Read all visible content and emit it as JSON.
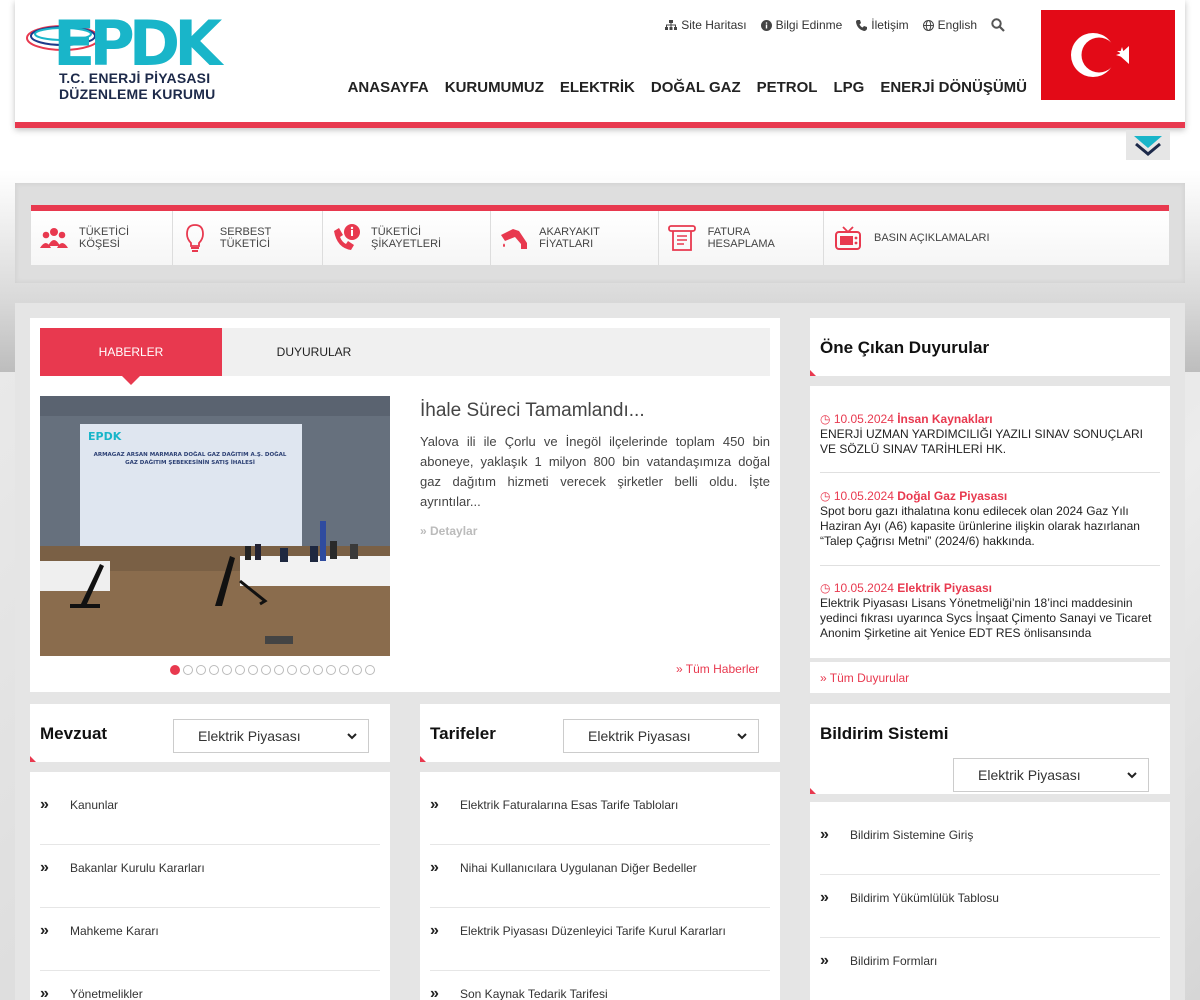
{
  "logo": {
    "text": "EPDK",
    "line1": "T.C. ENERJİ PİYASASI",
    "line2": "DÜZENLEME KURUMU"
  },
  "top_links": [
    {
      "label": "Site Haritası",
      "icon": "sitemap-icon"
    },
    {
      "label": "Bilgi Edinme",
      "icon": "info-icon"
    },
    {
      "label": "İletişim",
      "icon": "phone-icon"
    },
    {
      "label": "English",
      "icon": "globe-icon"
    }
  ],
  "main_nav": [
    "ANASAYFA",
    "KURUMUMUZ",
    "ELEKTRİK",
    "DOĞAL GAZ",
    "PETROL",
    "LPG",
    "ENERJİ DÖNÜŞÜMÜ"
  ],
  "quick_links": [
    {
      "label": "TÜKETİCİ KÖŞESİ",
      "icon": "people-icon"
    },
    {
      "label": "SERBEST TÜKETİCİ",
      "icon": "lightbulb-icon"
    },
    {
      "label": "TÜKETİCİ ŞİKAYETLERİ",
      "icon": "complaint-phone-icon"
    },
    {
      "label": "AKARYAKIT FİYATLARI",
      "icon": "fuel-nozzle-icon"
    },
    {
      "label": "FATURA HESAPLAMA",
      "icon": "invoice-icon"
    },
    {
      "label": "BASIN AÇIKLAMALARI",
      "icon": "tv-icon"
    }
  ],
  "news": {
    "tabs": [
      "HABERLER",
      "DUYURULAR"
    ],
    "title": "İhale Süreci Tamamlandı...",
    "body": "Yalova ili ile Çorlu ve İnegöl ilçelerinde toplam 450 bin aboneye, yaklaşık 1 milyon 800 bin vatandaşımıza doğal gaz dağıtım hizmeti verecek şirketler belli oldu. İşte ayrıntılar...",
    "details": "Detaylar",
    "all_news": "Tüm Haberler",
    "slide_count": 16,
    "active_slide": 1,
    "screen_logo": "EPDK",
    "screen_text": "ARMAGAZ ARSAN MARMARA DOĞAL GAZ DAĞITIM A.Ş. DOĞAL GAZ DAĞITIM ŞEBEKESİNİN SATIŞ İHALESİ"
  },
  "featured": {
    "title": "Öne Çıkan Duyurular",
    "items": [
      {
        "date": "10.05.2024",
        "category": "İnsan Kaynakları",
        "text": "ENERJİ UZMAN YARDIMCILIĞI YAZILI SINAV SONUÇLARI VE SÖZLÜ SINAV TARİHLERİ HK."
      },
      {
        "date": "10.05.2024",
        "category": "Doğal Gaz Piyasası",
        "text": "Spot boru gazı ithalatına konu edilecek olan 2024 Gaz Yılı Haziran Ayı (A6) kapasite ürünlerine ilişkin olarak hazırlanan “Talep Çağrısı Metni” (2024/6) hakkında."
      },
      {
        "date": "10.05.2024",
        "category": "Elektrik Piyasası",
        "text": "Elektrik Piyasası Lisans Yönetmeliği’nin 18’inci maddesinin yedinci fıkrası uyarınca Sycs İnşaat Çimento Sanayi ve Ticaret Anonim Şirketine ait Yenice EDT RES önlisansında"
      }
    ],
    "all": "Tüm Duyurular"
  },
  "mevzuat": {
    "title": "Mevzuat",
    "select": "Elektrik Piyasası",
    "items": [
      "Kanunlar",
      "Bakanlar Kurulu Kararları",
      "Mahkeme Kararı",
      "Yönetmelikler"
    ]
  },
  "tarifeler": {
    "title": "Tarifeler",
    "select": "Elektrik Piyasası",
    "items": [
      "Elektrik Faturalarına Esas Tarife Tabloları",
      "Nihai Kullanıcılara Uygulanan Diğer Bedeller",
      "Elektrik Piyasası Düzenleyici Tarife Kurul Kararları",
      "Son Kaynak Tedarik Tarifesi"
    ]
  },
  "bildirim": {
    "title": "Bildirim Sistemi",
    "select": "Elektrik Piyasası",
    "items": [
      "Bildirim Sistemine Giriş",
      "Bildirim Yükümlülük Tablosu",
      "Bildirim Formları"
    ]
  },
  "colors": {
    "accent": "#e8394f",
    "logo_teal": "#19b5c9",
    "flag_red": "#e30a17"
  }
}
